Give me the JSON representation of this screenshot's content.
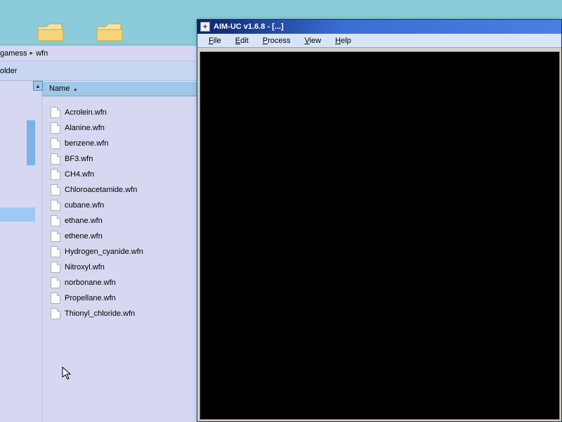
{
  "desktop": {},
  "explorer": {
    "path": {
      "seg1": "gamess",
      "seg2": "wfn"
    },
    "toolbar": {
      "label": "older"
    },
    "column_header": "Name",
    "files": [
      "Acrolein.wfn",
      "Alanine.wfn",
      "benzene.wfn",
      "BF3.wfn",
      "CH4.wfn",
      "Chloroacetamide.wfn",
      "cubane.wfn",
      "ethane.wfn",
      "ethene.wfn",
      "Hydrogen_cyanide.wfn",
      "Nitroxyl.wfn",
      "norbonane.wfn",
      "Propellane.wfn",
      "Thionyl_chloride.wfn"
    ]
  },
  "aim": {
    "title": "AIM-UC v1.6.8 - [...]",
    "menu": {
      "file": "File",
      "edit": "Edit",
      "process": "Process",
      "view": "View",
      "help": "Help"
    }
  }
}
